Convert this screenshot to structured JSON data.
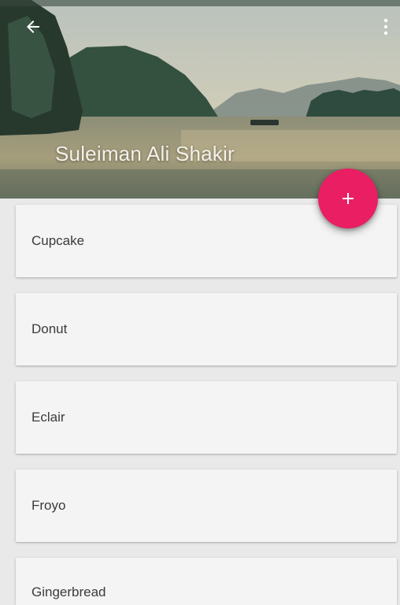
{
  "header": {
    "title": "Suleiman Ali Shakir",
    "back_icon": "arrow-back-icon",
    "menu_icon": "more-vert-icon"
  },
  "fab": {
    "icon": "add-icon",
    "label": "+"
  },
  "list": {
    "items": [
      {
        "label": "Cupcake"
      },
      {
        "label": "Donut"
      },
      {
        "label": "Eclair"
      },
      {
        "label": "Froyo"
      },
      {
        "label": "Gingerbread"
      }
    ]
  },
  "colors": {
    "accent": "#e91e63",
    "background": "#e9e9e9",
    "card": "#f4f4f4"
  }
}
